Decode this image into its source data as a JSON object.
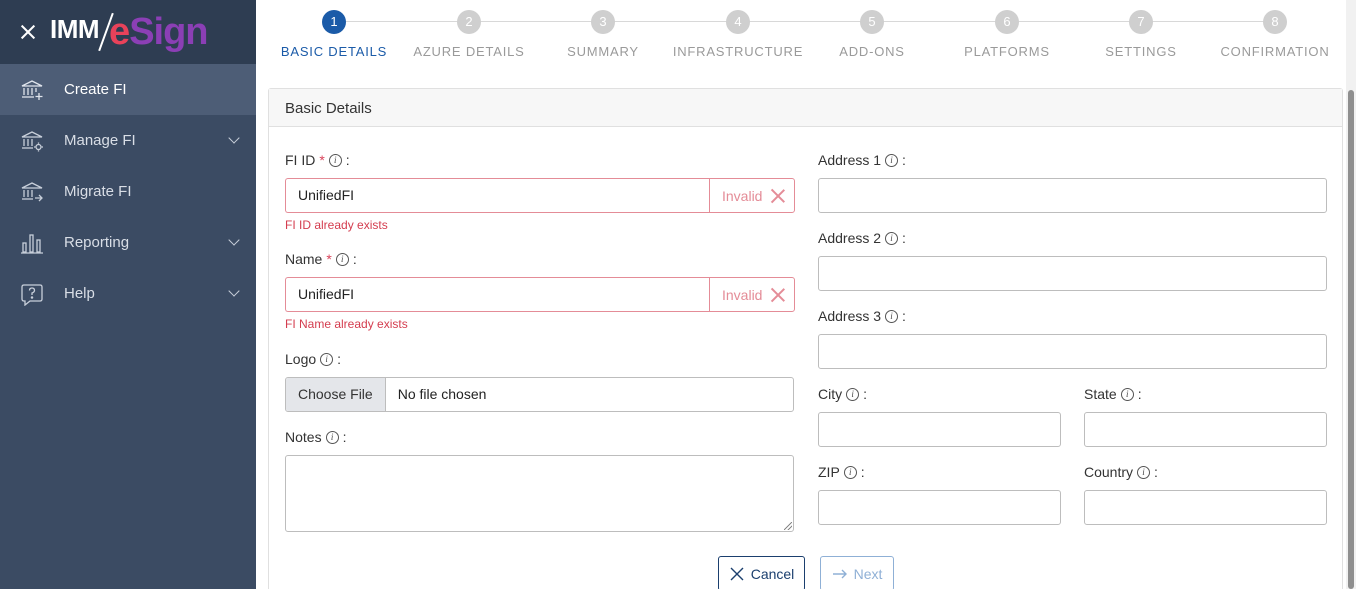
{
  "brand": {
    "prefix": "IMM",
    "e": "e",
    "sign": "Sign"
  },
  "sidebar": {
    "items": [
      {
        "label": "Create FI",
        "icon": "bank-add-icon",
        "active": true
      },
      {
        "label": "Manage FI",
        "icon": "bank-settings-icon",
        "expandable": true
      },
      {
        "label": "Migrate FI",
        "icon": "bank-migrate-icon"
      },
      {
        "label": "Reporting",
        "icon": "bar-chart-icon",
        "expandable": true
      },
      {
        "label": "Help",
        "icon": "help-icon",
        "expandable": true
      }
    ]
  },
  "stepper": {
    "steps": [
      {
        "num": "1",
        "label": "BASIC DETAILS",
        "active": true
      },
      {
        "num": "2",
        "label": "AZURE DETAILS"
      },
      {
        "num": "3",
        "label": "SUMMARY"
      },
      {
        "num": "4",
        "label": "INFRASTRUCTURE"
      },
      {
        "num": "5",
        "label": "ADD-ONS"
      },
      {
        "num": "6",
        "label": "PLATFORMS"
      },
      {
        "num": "7",
        "label": "SETTINGS"
      },
      {
        "num": "8",
        "label": "CONFIRMATION"
      }
    ]
  },
  "form": {
    "title": "Basic Details",
    "fi_id": {
      "label": "FI ID",
      "value": "UnifiedFI",
      "status": "Invalid",
      "error": "FI ID already exists"
    },
    "name": {
      "label": "Name",
      "value": "UnifiedFI",
      "status": "Invalid",
      "error": "FI Name already exists"
    },
    "logo": {
      "label": "Logo",
      "button": "Choose File",
      "text": "No file chosen"
    },
    "notes": {
      "label": "Notes"
    },
    "address1": {
      "label": "Address 1"
    },
    "address2": {
      "label": "Address 2"
    },
    "address3": {
      "label": "Address 3"
    },
    "city": {
      "label": "City"
    },
    "state": {
      "label": "State"
    },
    "zip": {
      "label": "ZIP"
    },
    "country": {
      "label": "Country"
    },
    "required_mark": "*",
    "info_glyph": "i",
    "colon": ":"
  },
  "actions": {
    "cancel": "Cancel",
    "next": "Next"
  },
  "colors": {
    "sidebar": "#3b4b63",
    "accent": "#1b5ba8",
    "error": "#d43d4f"
  }
}
